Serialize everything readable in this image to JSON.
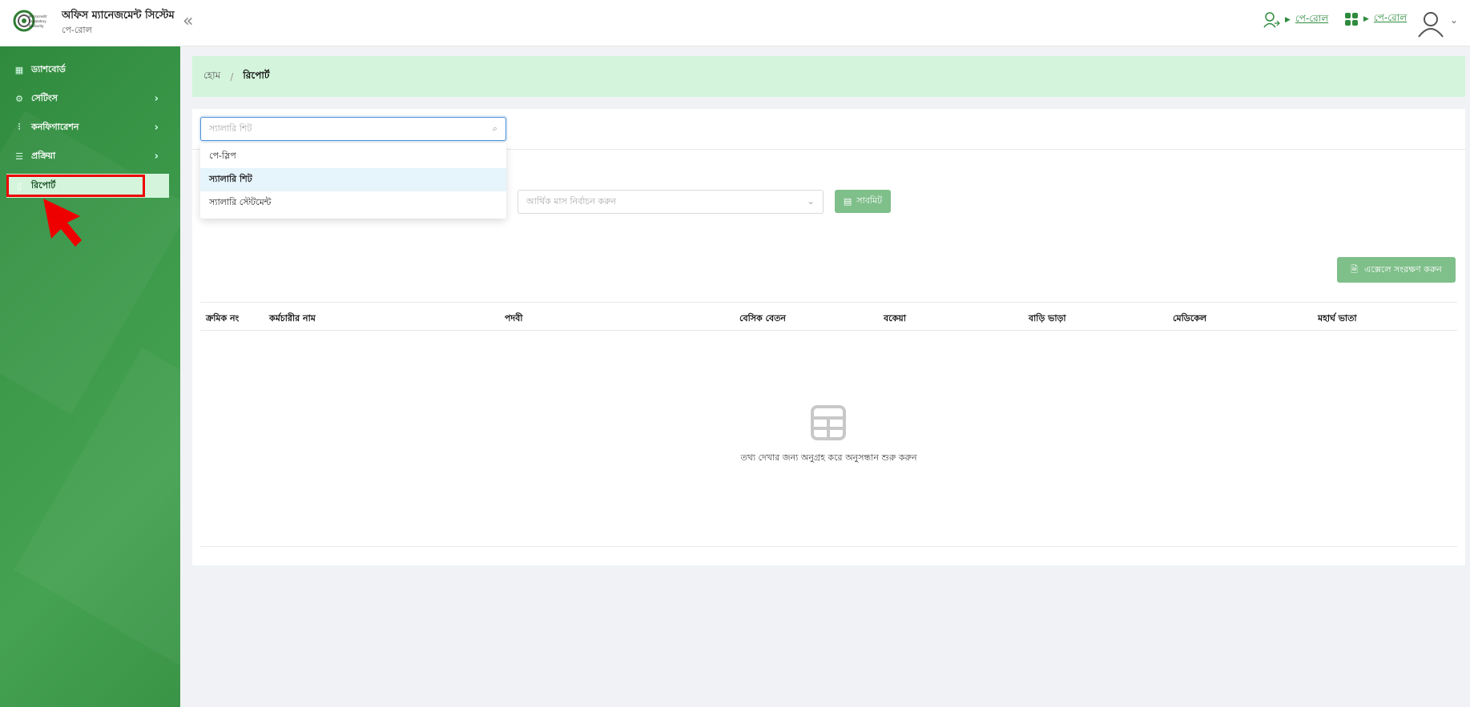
{
  "header": {
    "app_title": "অফিস ম্যানেজমেন্ট সিস্টেম",
    "app_subtitle": "পে-রোল",
    "logo_text": "Microcredit Regulatory Authority",
    "collapse_icon": "double-chevron-left-icon",
    "module_link_1": "পে-রোল",
    "module_link_2": "পে-রোল",
    "accent_color": "#2e8b3e"
  },
  "sidebar": {
    "items": [
      {
        "label": "ড্যাশবোর্ড",
        "icon": "dashboard-icon"
      },
      {
        "label": "সেটিংস",
        "icon": "gear-icon"
      },
      {
        "label": "কনফিগারেশন",
        "icon": "sliders-icon"
      },
      {
        "label": "প্রক্রিয়া",
        "icon": "filter-icon"
      },
      {
        "label": "রিপোর্ট",
        "icon": "document-icon"
      }
    ]
  },
  "breadcrumb": {
    "home": "হোম",
    "separator": "/",
    "current": "রিপোর্ট"
  },
  "report_select": {
    "placeholder": "স্যালারি শিট",
    "options": [
      "পে-স্লিপ",
      "স্যালারি শিট",
      "স্যালারি স্টেটমেন্ট"
    ],
    "selected": "স্যালারি শিট"
  },
  "filters": {
    "month_placeholder": "আর্থিক মাস নির্বাচন করুন",
    "submit_label": "সাবমিট"
  },
  "actions": {
    "excel_label": "এক্সেলে সংরক্ষণ করুন"
  },
  "table": {
    "columns": [
      "ক্রমিক নং",
      "কর্মচারীর নাম",
      "পদবী",
      "বেসিক বেতন",
      "বকেয়া",
      "বাড়ি ভাড়া",
      "মেডিকেল",
      "মহার্ঘ ভাতা"
    ],
    "empty_text": "তথ্য দেখার জন্য অনুগ্রহ করে অনুসন্ধান শুরু করুন"
  }
}
